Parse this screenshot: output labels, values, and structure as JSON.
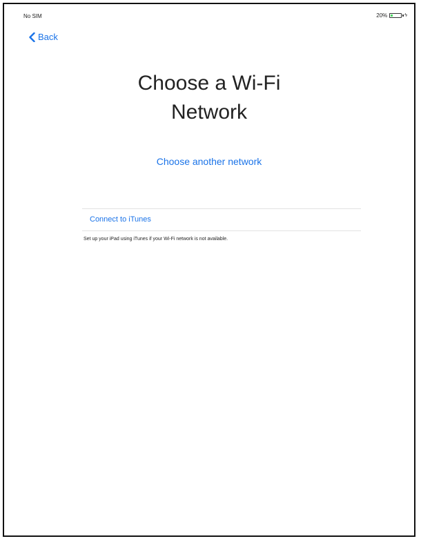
{
  "status_bar": {
    "carrier": "No SIM",
    "battery_percent": "20%",
    "battery_level": 0.2,
    "charging_icon": "bolt-icon"
  },
  "nav": {
    "back_label": "Back",
    "back_icon": "chevron-left-icon"
  },
  "main": {
    "title_line1": "Choose a Wi-Fi",
    "title_line2": "Network",
    "choose_another_label": "Choose another network",
    "connect_itunes_label": "Connect to iTunes",
    "itunes_note": "Set up your iPad using iTunes if your Wi-Fi network is not available."
  },
  "colors": {
    "accent": "#1a73e8",
    "text": "#222222",
    "background": "#ffffff",
    "divider": "#e2e2e2",
    "battery_fill": "#4cd964"
  }
}
